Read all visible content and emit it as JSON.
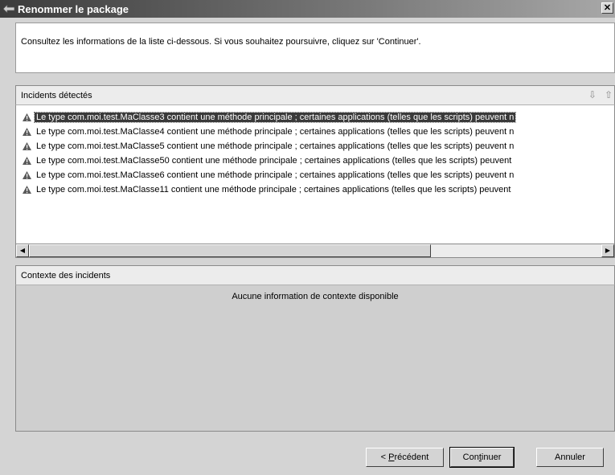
{
  "window": {
    "title": "Renommer le package",
    "close_label": "✕"
  },
  "message": "Consultez les informations de la liste ci-dessous. Si vous souhaitez poursuivre, cliquez sur 'Continuer'.",
  "incidents": {
    "header": "Incidents détectés",
    "rows": [
      "Le type com.moi.test.MaClasse3 contient une méthode principale ; certaines applications (telles que les scripts) peuvent n",
      "Le type com.moi.test.MaClasse4 contient une méthode principale ; certaines applications (telles que les scripts) peuvent n",
      "Le type com.moi.test.MaClasse5 contient une méthode principale ; certaines applications (telles que les scripts) peuvent n",
      "Le type com.moi.test.MaClasse50 contient une méthode principale ; certaines applications (telles que les scripts) peuvent",
      "Le type com.moi.test.MaClasse6 contient une méthode principale ; certaines applications (telles que les scripts) peuvent n",
      "Le type com.moi.test.MaClasse11 contient une méthode principale ; certaines applications (telles que les scripts) peuvent"
    ],
    "selected_index": 0,
    "icons": [
      "arrow-down-icon",
      "arrow-up-icon"
    ]
  },
  "context": {
    "header": "Contexte des incidents",
    "empty_message": "Aucune information de contexte disponible"
  },
  "buttons": {
    "prev": {
      "before": "< ",
      "mnemonic": "P",
      "after": "récédent"
    },
    "next": {
      "before": "Con",
      "mnemonic": "t",
      "after": "inuer"
    },
    "cancel": "Annuler"
  },
  "colors": {
    "selection_bg": "#3a3a3a",
    "dialog_bg": "#d4d4d4"
  }
}
